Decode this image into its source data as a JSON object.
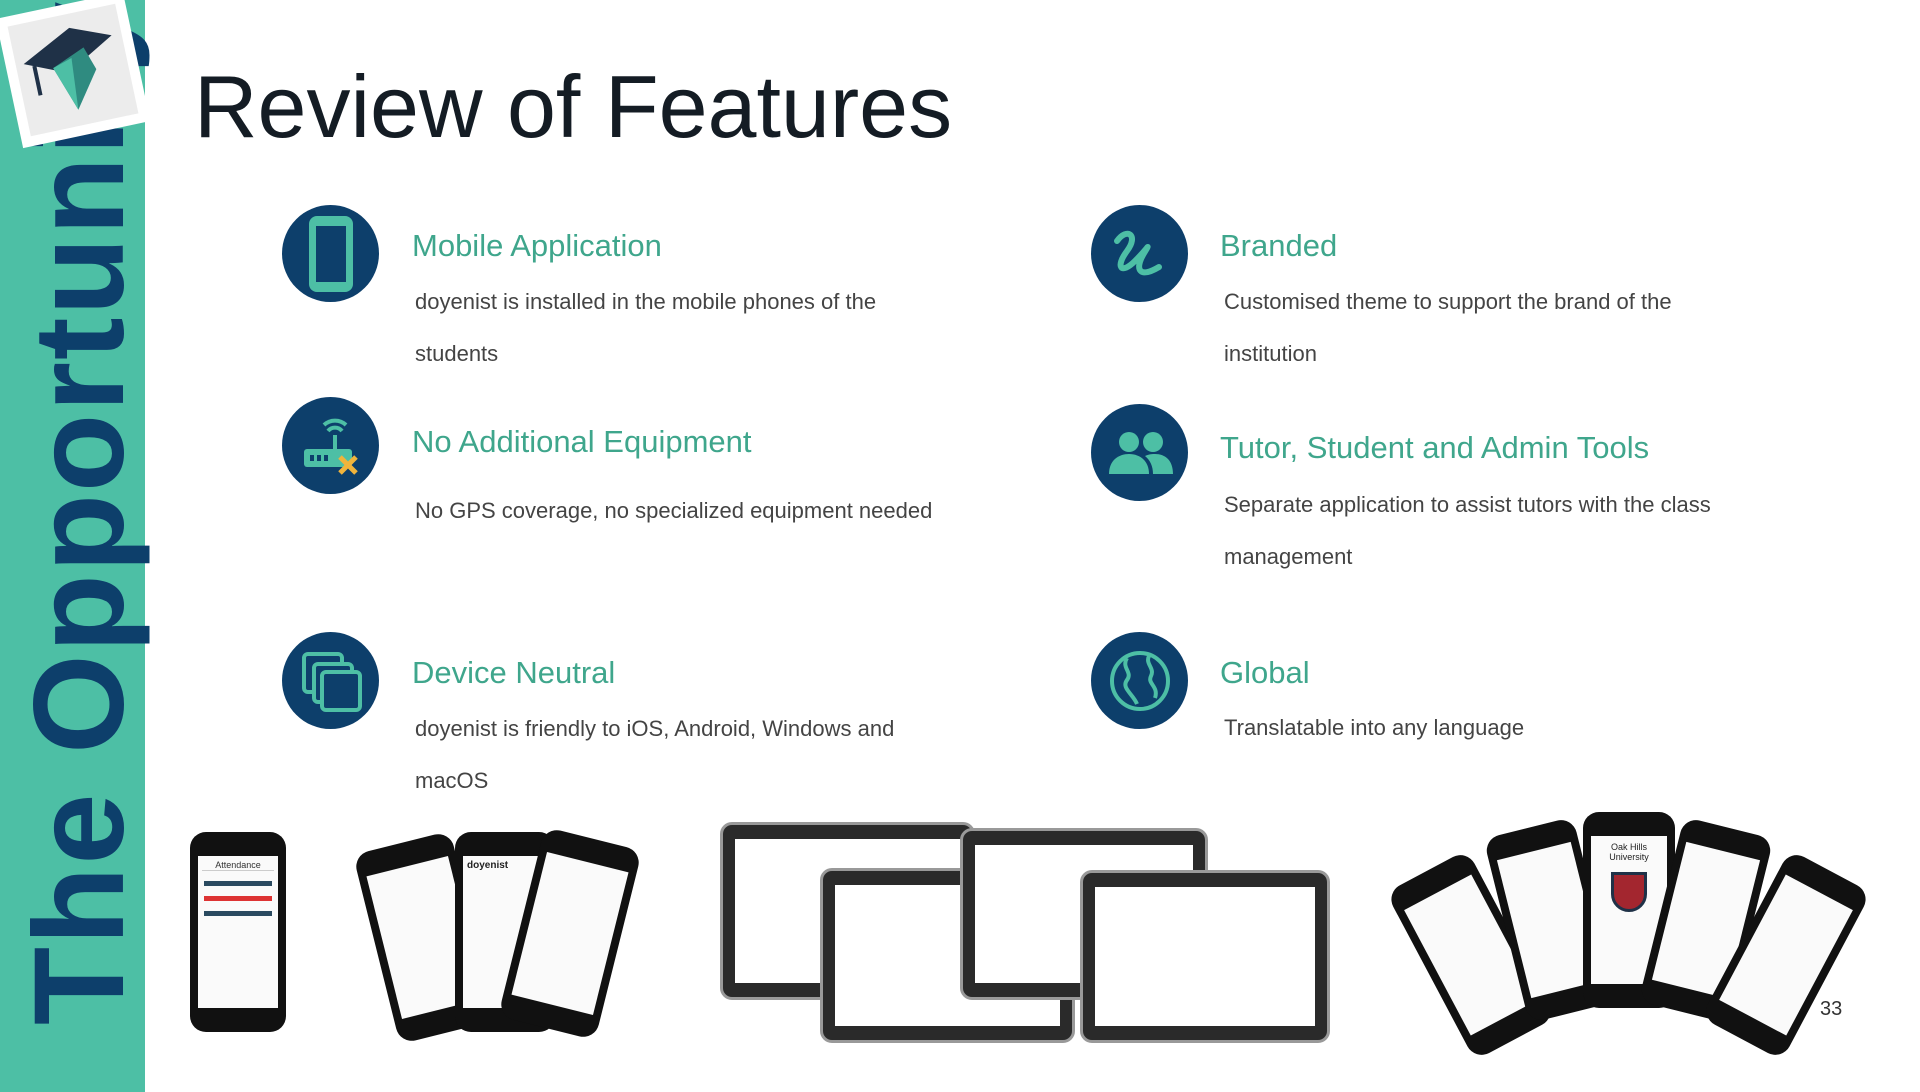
{
  "sidebar": {
    "vertical_title": "The Opportunity",
    "accent": "#4dbfa5",
    "text_color": "#0d3f6b"
  },
  "title": "Review of Features",
  "features": [
    {
      "icon": "mobile-phone-icon",
      "heading": "Mobile Application",
      "lines": [
        "doyenist is installed in the mobile phones of the",
        "students"
      ]
    },
    {
      "icon": "router-no-icon",
      "heading": "No Additional Equipment",
      "lines": [
        "No GPS coverage, no specialized equipment needed"
      ]
    },
    {
      "icon": "devices-icon",
      "heading": "Device Neutral",
      "lines": [
        "doyenist is friendly to iOS, Android, Windows and",
        "macOS"
      ]
    },
    {
      "icon": "brand-signature-icon",
      "heading": "Branded",
      "lines": [
        "Customised theme to support the brand of the",
        "institution"
      ]
    },
    {
      "icon": "users-icon",
      "heading": "Tutor, Student and Admin Tools",
      "lines": [
        "Separate application to assist tutors with the class",
        "management"
      ]
    },
    {
      "icon": "globe-icon",
      "heading": "Global",
      "lines": [
        "Translatable into any language"
      ]
    }
  ],
  "mockups": {
    "phone_header": "Attendance",
    "app_name": "doyenist",
    "university": "Oak Hills University"
  },
  "colors": {
    "heading": "#3fa68c",
    "icon_bg": "#0d3f6b",
    "icon_fg": "#4dbfa5",
    "warn": "#f0b43c"
  },
  "page_number": "33"
}
